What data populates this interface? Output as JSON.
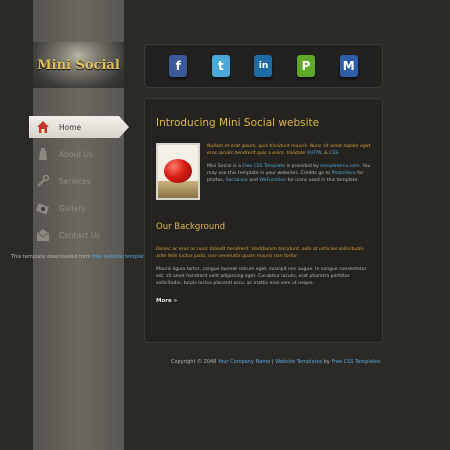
{
  "logo": "Mini Social",
  "nav": [
    {
      "label": "Home",
      "icon": "home-icon",
      "active": true
    },
    {
      "label": "About Us",
      "icon": "bottle-icon",
      "active": false
    },
    {
      "label": "Services",
      "icon": "wrench-icon",
      "active": false
    },
    {
      "label": "Gallery",
      "icon": "camera-icon",
      "active": false
    },
    {
      "label": "Contact Us",
      "icon": "mail-icon",
      "active": false
    }
  ],
  "credit": {
    "prefix": "This template downloaded form ",
    "link": "free website templates"
  },
  "social": [
    {
      "name": "facebook-icon",
      "glyph": "f",
      "color": "#3b5998"
    },
    {
      "name": "twitter-icon",
      "glyph": "t",
      "color": "#4aa9d6"
    },
    {
      "name": "linkedin-icon",
      "glyph": "in",
      "color": "#1f6ca5"
    },
    {
      "name": "plurk-icon",
      "glyph": "P",
      "color": "#5fa829"
    },
    {
      "name": "myspace-icon",
      "glyph": "M",
      "color": "#2f5ea8"
    }
  ],
  "content": {
    "title": "Introducing Mini Social website",
    "intro_italic_1": "Nullam et erat ipsum, quis tincidunt mauris. Nunc sit amet sapien eget eros iaculis hendrerit quis a enim. Validate ",
    "xhtml": "XHTML",
    "amp": " & ",
    "css": "CSS",
    "intro_text_1": "Mini Social is a ",
    "fct": "Free CSS Template",
    "intro_text_2": " is provided by ",
    "tm": "templatemo.com",
    "intro_text_3": ". You may use this template in your websites. Credits go to ",
    "photovaco": "PhotoVaco",
    "intro_text_4": " for photos, ",
    "sociali": "SociaLme",
    "intro_text_5": " and ",
    "wefunction": "WeFunction",
    "intro_text_6": " for icons used in this template.",
    "bg_title": "Our Background",
    "bg_italic": "Donec ac eros ac nunc blandit hendrerit. Vestibulum tincidunt, odio at ultricies sollicitudin, ante felis luctus justo, non venenatis quam mauris non tortor.",
    "bg_text": "Mauris ligula tortor, congue laoreet rutrum eget, suscipit nec augue. In congue consectetur est, sit amet hendrerit velit adipiscing eget. Curabitur iaculis, erat pharetra porttitor sollicitudin, turpis lectus placerat arcu, ac mattis eros sem ut neque.",
    "more": "More »"
  },
  "footer": {
    "prefix": "Copyright © 2048 ",
    "company": "Your Company Name",
    "sep": " | ",
    "wt": "Website Templates",
    "by": " by ",
    "fct": "Free CSS Templates"
  }
}
